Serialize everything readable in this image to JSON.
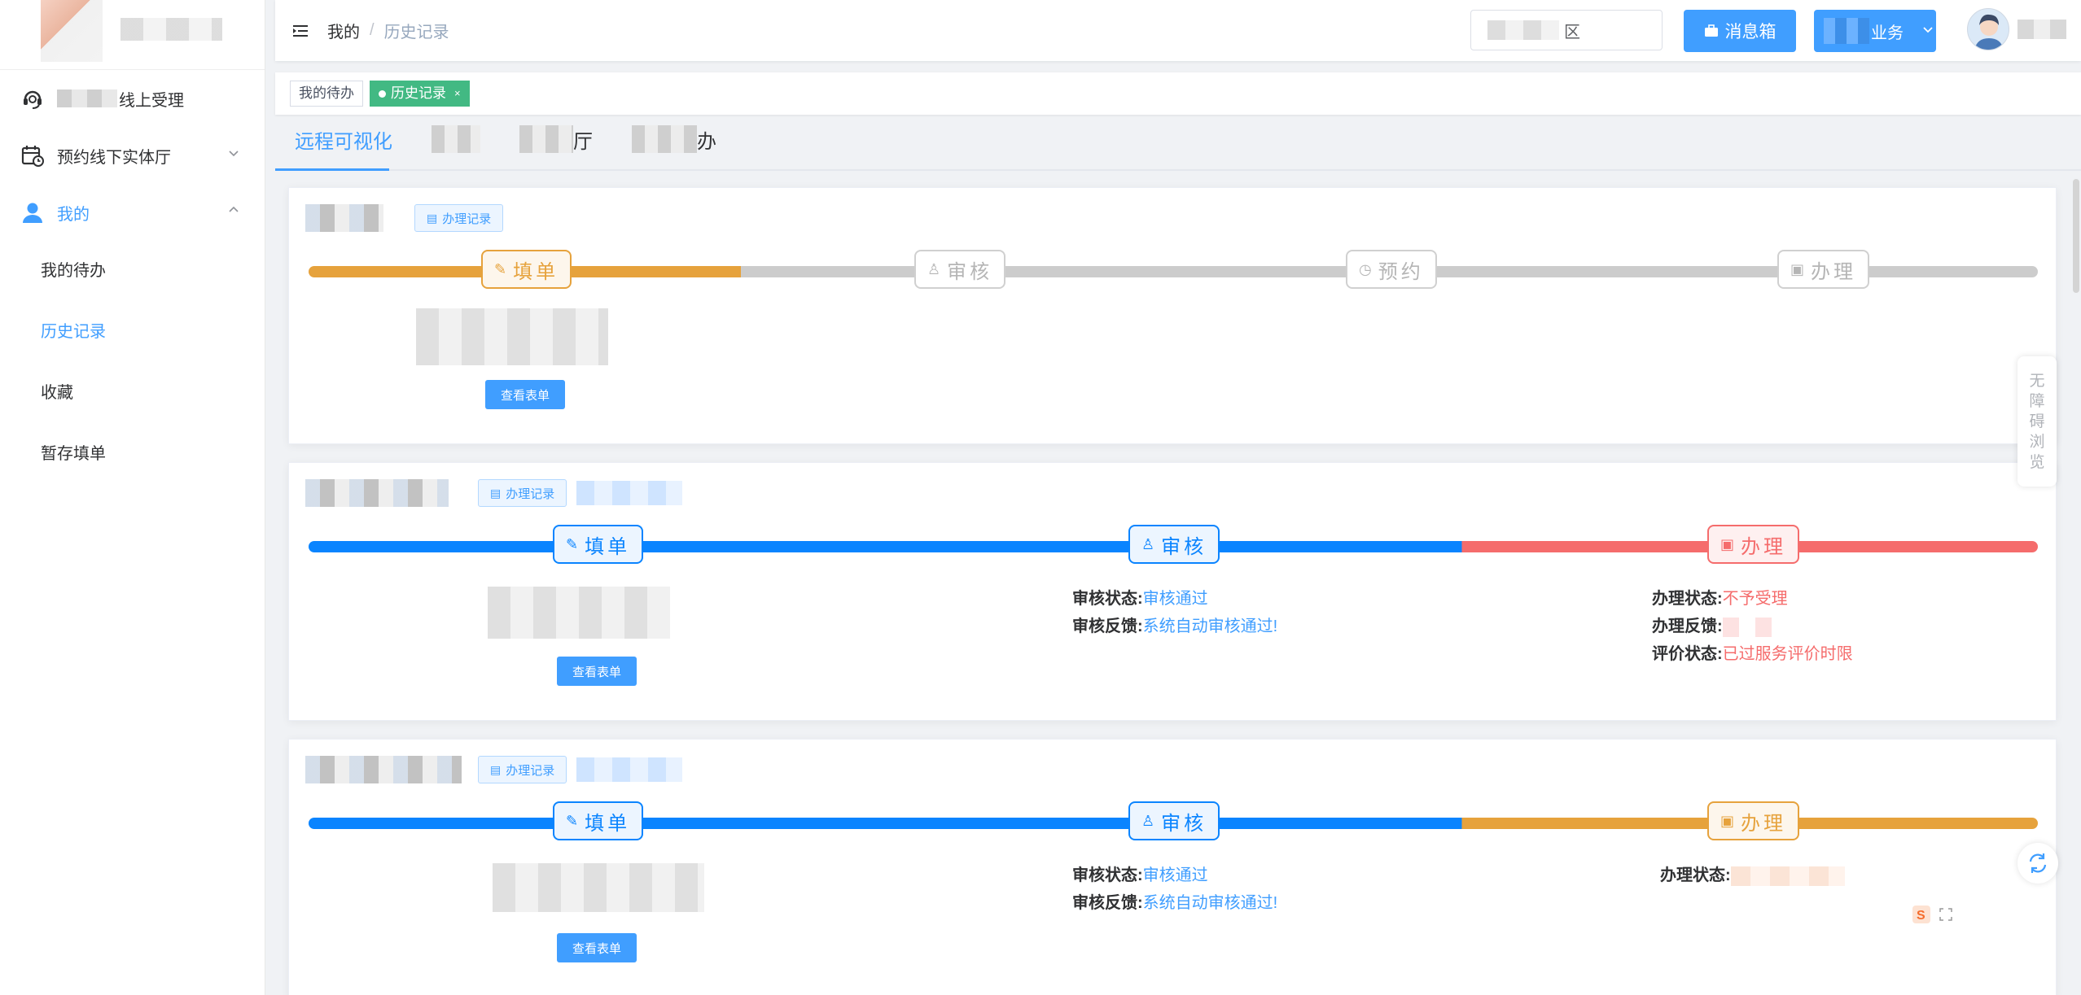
{
  "sidebar": {
    "items": [
      {
        "label": "线上受理",
        "icon": "headset-icon"
      },
      {
        "label": "预约线下实体厅",
        "icon": "calendar-icon"
      },
      {
        "label": "我的",
        "icon": "user-icon"
      }
    ],
    "submenu": [
      "我的待办",
      "历史记录",
      "收藏",
      "暂存填单"
    ],
    "active_sub": "历史记录"
  },
  "header": {
    "breadcrumb": [
      "我的",
      "历史记录"
    ],
    "region_suffix": "区",
    "message_button": "消息箱",
    "business_button_suffix": "业务"
  },
  "tagsview": {
    "tags": [
      "我的待办",
      "历史记录"
    ],
    "close_glyph": "×"
  },
  "tabs": {
    "active": "远程可视化",
    "others_suffix": [
      "厅",
      "办"
    ]
  },
  "cards": [
    {
      "record_button": "办理记录",
      "steps": [
        "填单",
        "审核",
        "预约",
        "办理"
      ],
      "view_form": "查看表单"
    },
    {
      "record_button": "办理记录",
      "steps": [
        "填单",
        "审核",
        "办理"
      ],
      "view_form": "查看表单",
      "audit_status_label": "审核状态:",
      "audit_status": "审核通过",
      "audit_feedback_label": "审核反馈:",
      "audit_feedback": "系统自动审核通过!",
      "handle_status_label": "办理状态:",
      "handle_status": "不予受理",
      "handle_feedback_label": "办理反馈:",
      "eval_status_label": "评价状态:",
      "eval_status": "已过服务评价时限"
    },
    {
      "record_button": "办理记录",
      "steps": [
        "填单",
        "审核",
        "办理"
      ],
      "view_form": "查看表单",
      "audit_status_label": "审核状态:",
      "audit_status": "审核通过",
      "audit_feedback_label": "审核反馈:",
      "audit_feedback": "系统自动审核通过!",
      "handle_status_label": "办理状态:"
    }
  ],
  "widgets": {
    "accessibility": [
      "无",
      "障",
      "碍",
      "浏",
      "览"
    ]
  },
  "colors": {
    "primary": "#409eff",
    "success_tag": "#42b983",
    "orange": "#e6a23c",
    "red": "#f56c6c",
    "gray_track": "#cccccc",
    "blue_track": "#0a84ff"
  }
}
